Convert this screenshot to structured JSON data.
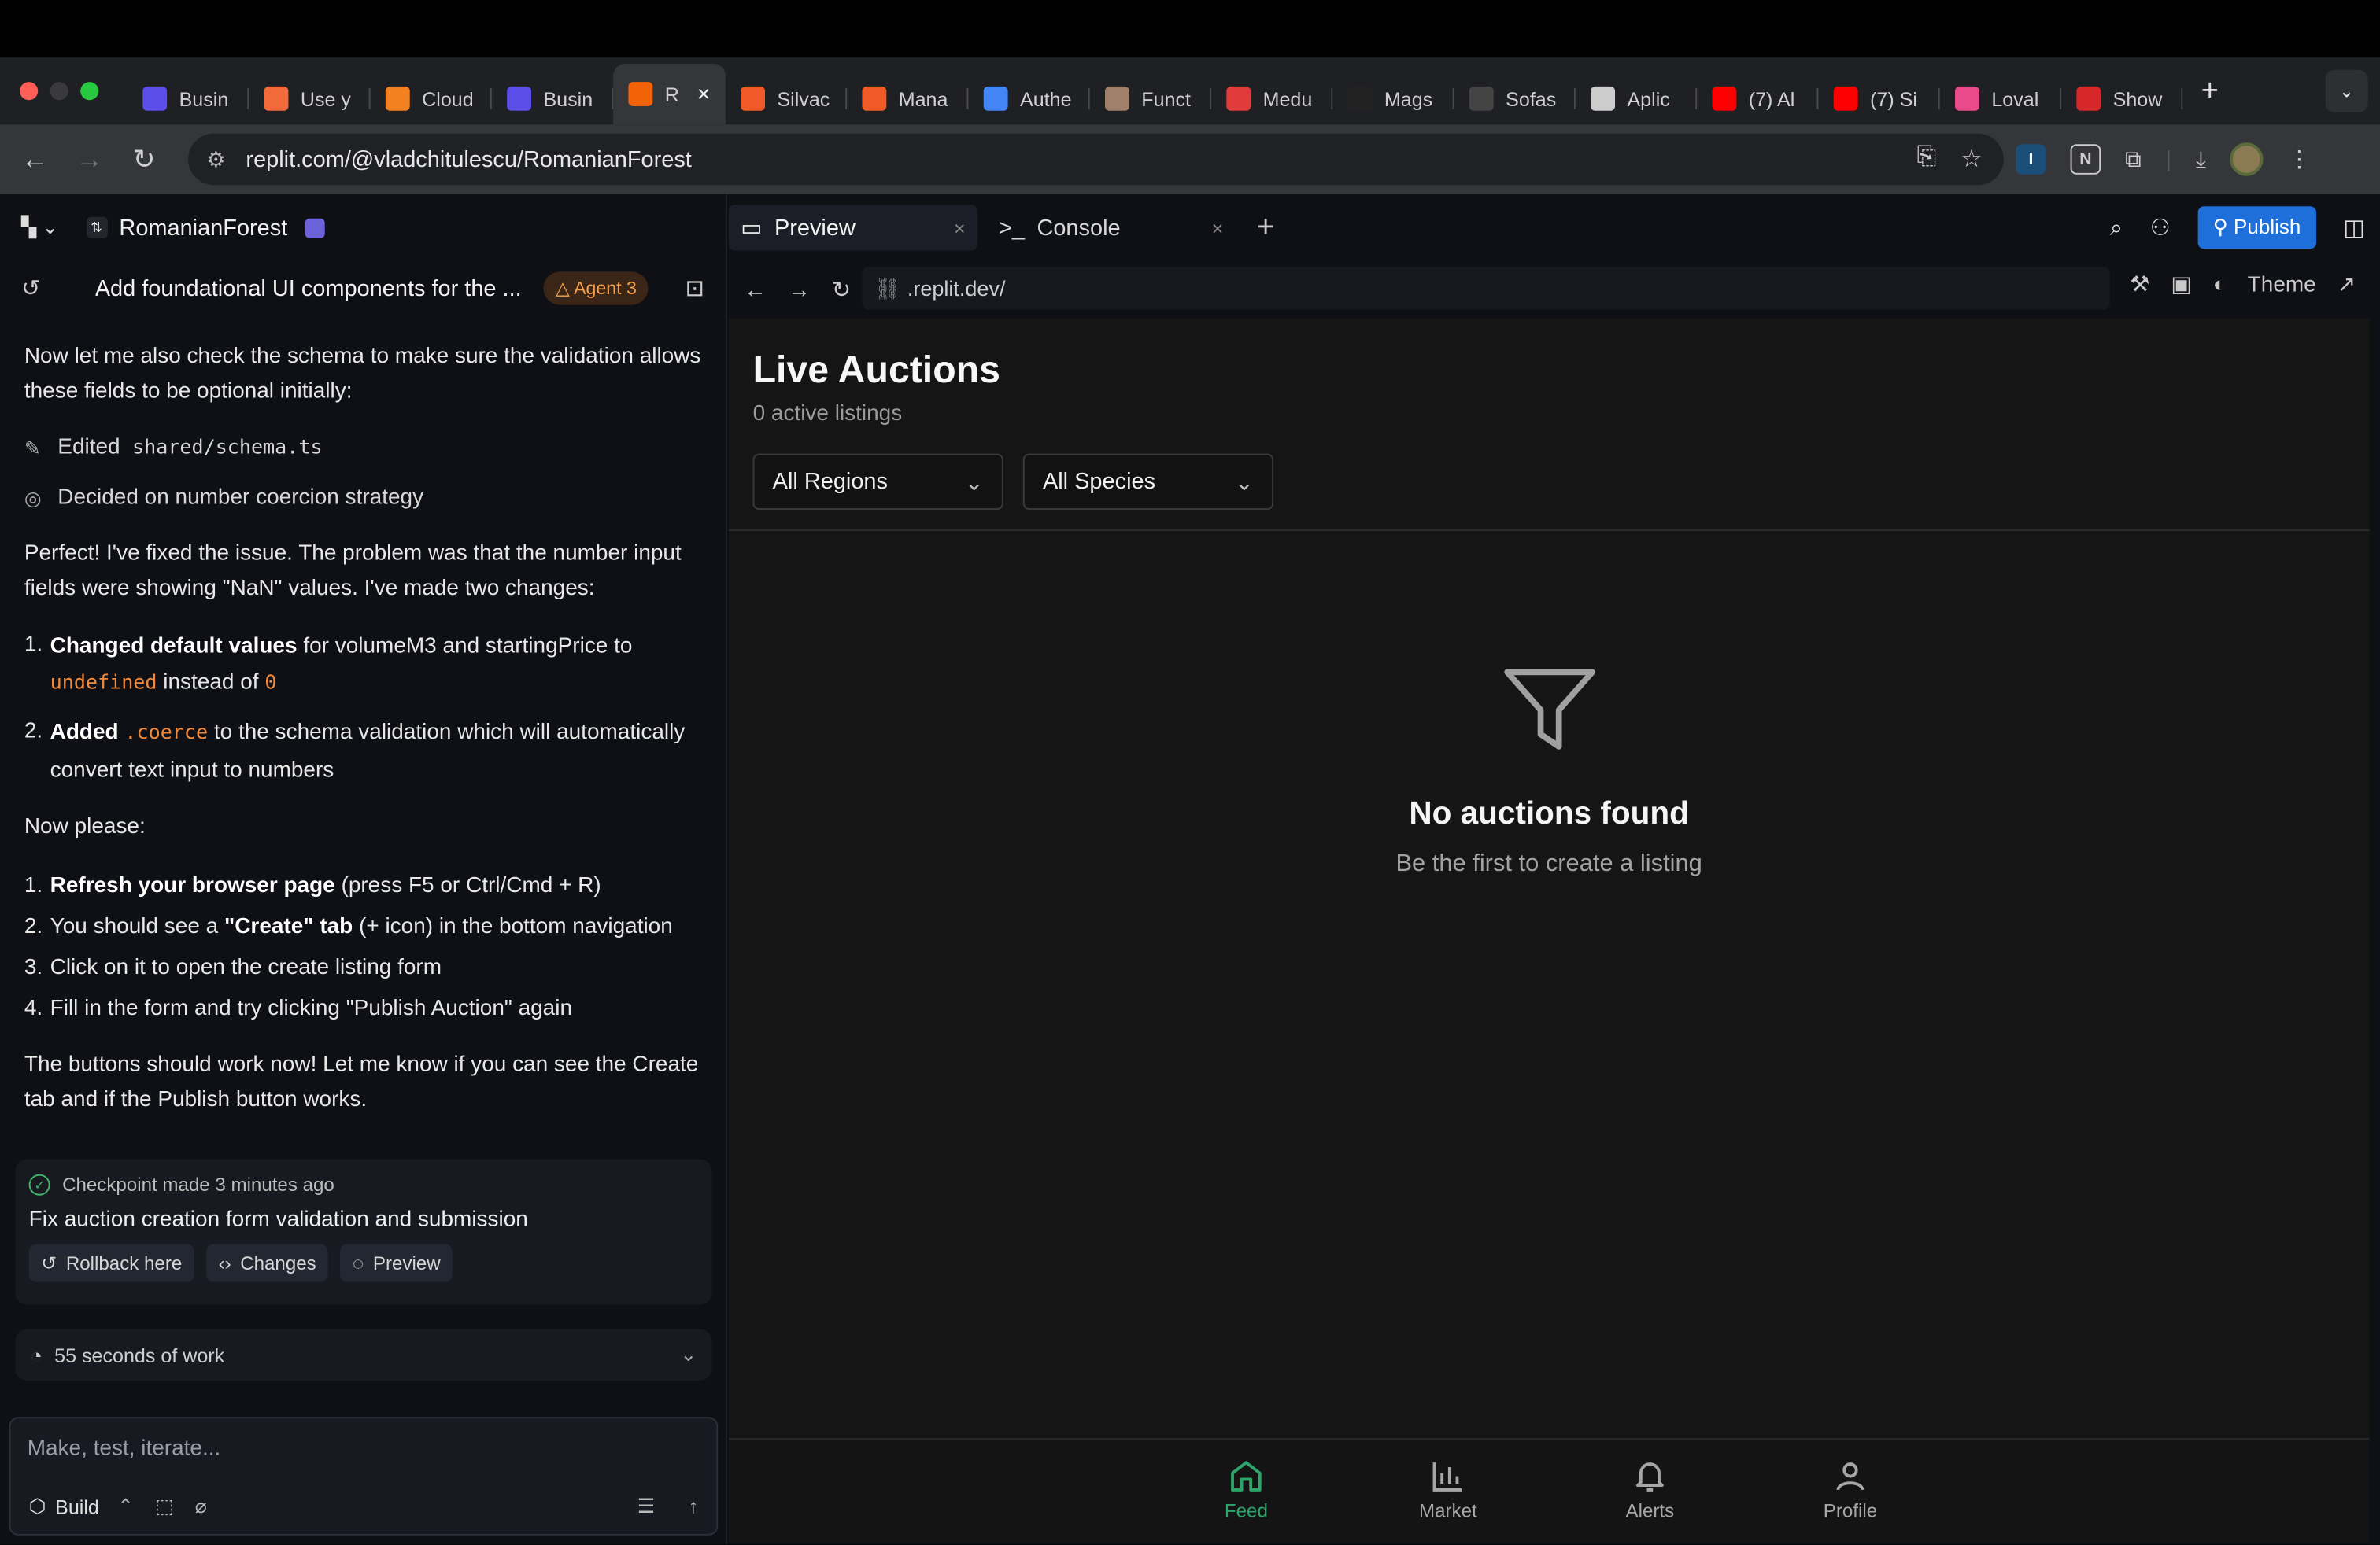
{
  "browser": {
    "tabs": [
      {
        "label": "Busin",
        "color": "#5b4ee6"
      },
      {
        "label": "Use y",
        "color": "#f26a3a"
      },
      {
        "label": "Cloud",
        "color": "#f48120"
      },
      {
        "label": "Busin",
        "color": "#5b4ee6"
      },
      {
        "label": "R",
        "color": "#f26207",
        "active": true
      },
      {
        "label": "Silvac",
        "color": "#f05a28"
      },
      {
        "label": "Mana",
        "color": "#f05a28"
      },
      {
        "label": "Authe",
        "color": "#4285f4"
      },
      {
        "label": "Funct",
        "color": "#a0806a"
      },
      {
        "label": "Medu",
        "color": "#e03a3a"
      },
      {
        "label": "Mags",
        "color": "#222222"
      },
      {
        "label": "Sofas",
        "color": "#444444"
      },
      {
        "label": "Aplic",
        "color": "#cccccc"
      },
      {
        "label": "(7) Al",
        "color": "#ff0000"
      },
      {
        "label": "(7) Si",
        "color": "#ff0000"
      },
      {
        "label": "Loval",
        "color": "#e84a8a"
      },
      {
        "label": "Show",
        "color": "#d62828"
      }
    ],
    "url": "replit.com/@vladchitulescu/RomanianForest"
  },
  "workspace": {
    "project_name": "RomanianForest",
    "thread_title": "Add foundational UI components for the ...",
    "agent_badge": "Agent 3"
  },
  "chat": {
    "intro": "Now let me also check the schema to make sure the validation allows these fields to be optional initially:",
    "action_edited_prefix": "Edited",
    "action_edited_file": "shared/schema.ts",
    "action_decided": "Decided on number coercion strategy",
    "fix_message": "Perfect! I've fixed the issue. The problem was that the number input fields were showing \"NaN\" values. I've made two changes:",
    "changes": [
      {
        "n": "1.",
        "bold": "Changed default values",
        "text1": " for volumeM3 and startingPrice to ",
        "code1": "undefined",
        "text2": " instead of ",
        "code2": "0"
      },
      {
        "n": "2.",
        "bold": "Added",
        "code1": ".coerce",
        "text1": " to the schema validation which will automatically convert text input to numbers"
      }
    ],
    "now_please": "Now please:",
    "steps": [
      {
        "n": "1.",
        "bold": "Refresh your browser page",
        "text": " (press F5 or Ctrl/Cmd + R)"
      },
      {
        "n": "2.",
        "pre": "You should see a ",
        "bold": "\"Create\" tab",
        "text": " (+ icon) in the bottom navigation"
      },
      {
        "n": "3.",
        "text": "Click on it to open the create listing form"
      },
      {
        "n": "4.",
        "text": "Fill in the form and try clicking \"Publish Auction\" again"
      }
    ],
    "closing": "The buttons should work now! Let me know if you can see the Create tab and if the Publish button works.",
    "checkpoint": {
      "label": "Checkpoint made 3 minutes ago",
      "title": "Fix auction creation form validation and submission",
      "rollback": "Rollback here",
      "changes": "Changes",
      "preview": "Preview"
    },
    "work_summary": "55 seconds of work",
    "composer_placeholder": "Make, test, iterate...",
    "build_label": "Build"
  },
  "panes": {
    "preview_tab": "Preview",
    "console_tab": "Console",
    "publish": "Publish",
    "preview_url": ".replit.dev/",
    "theme": "Theme"
  },
  "app": {
    "title": "Live Auctions",
    "subtitle": "0 active listings",
    "region_select": "All Regions",
    "species_select": "All Species",
    "empty_title": "No auctions found",
    "empty_sub": "Be the first to create a listing",
    "nav": [
      {
        "label": "Feed",
        "active": true
      },
      {
        "label": "Market"
      },
      {
        "label": "Alerts"
      },
      {
        "label": "Profile"
      }
    ],
    "accent": "#2ea46a"
  }
}
